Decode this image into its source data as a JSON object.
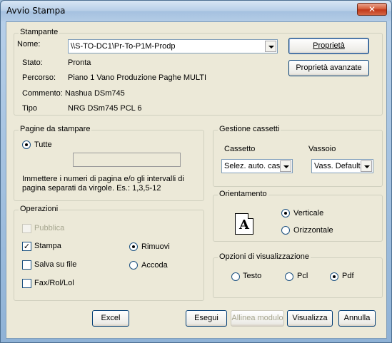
{
  "window": {
    "title": "Avvio Stampa",
    "close_glyph": "✕"
  },
  "printer": {
    "legend": "Stampante",
    "name_label": "Nome:",
    "name_value": "\\\\S-TO-DC1\\Pr-To-P1M-Prodp",
    "state_label": "Stato:",
    "state_value": "Pronta",
    "path_label": "Percorso:",
    "path_value": "Piano 1 Vano Produzione Paghe MULTI",
    "comment_label": "Commento:",
    "comment_value": "Nashua DSm745",
    "type_label": "Tipo",
    "type_value": "NRG DSm745 PCL 6",
    "properties_button": "Proprietà",
    "advanced_button": "Proprietà avanzate"
  },
  "pages": {
    "legend": "Pagine da stampare",
    "all_label": "Tutte",
    "all_selected": true,
    "range_value": "",
    "hint": "Immettere i numeri di pagina e/o gli intervalli di pagina separati da virgole. Es.: 1,3,5-12"
  },
  "trays": {
    "legend": "Gestione cassetti",
    "drawer_label": "Cassetto",
    "drawer_value": "Selez. auto. cas",
    "tray_label": "Vassoio",
    "tray_value": "Vass. Default"
  },
  "orientation": {
    "legend": "Orientamento",
    "icon_letter": "A",
    "vertical_label": "Verticale",
    "horizontal_label": "Orizzontale",
    "selected": "vertical"
  },
  "operations": {
    "legend": "Operazioni",
    "publish_label": "Pubblica",
    "print_label": "Stampa",
    "print_checked": true,
    "save_label": "Salva su file",
    "fax_label": "Fax/Rol/Lol",
    "remove_label": "Rimuovi",
    "queue_label": "Accoda",
    "selected": "remove"
  },
  "view": {
    "legend": "Opzioni di visualizzazione",
    "text_label": "Testo",
    "pcl_label": "Pcl",
    "pdf_label": "Pdf",
    "selected": "pdf"
  },
  "buttons": {
    "excel": "Excel",
    "run": "Esegui",
    "align": "Allinea modulo",
    "preview": "Visualizza",
    "cancel": "Annulla"
  },
  "colors": {
    "dialog_bg": "#ece9d8",
    "titlebar": "#b8cfe8",
    "close_button": "#c1391b",
    "disabled_text": "#a6a68f"
  }
}
